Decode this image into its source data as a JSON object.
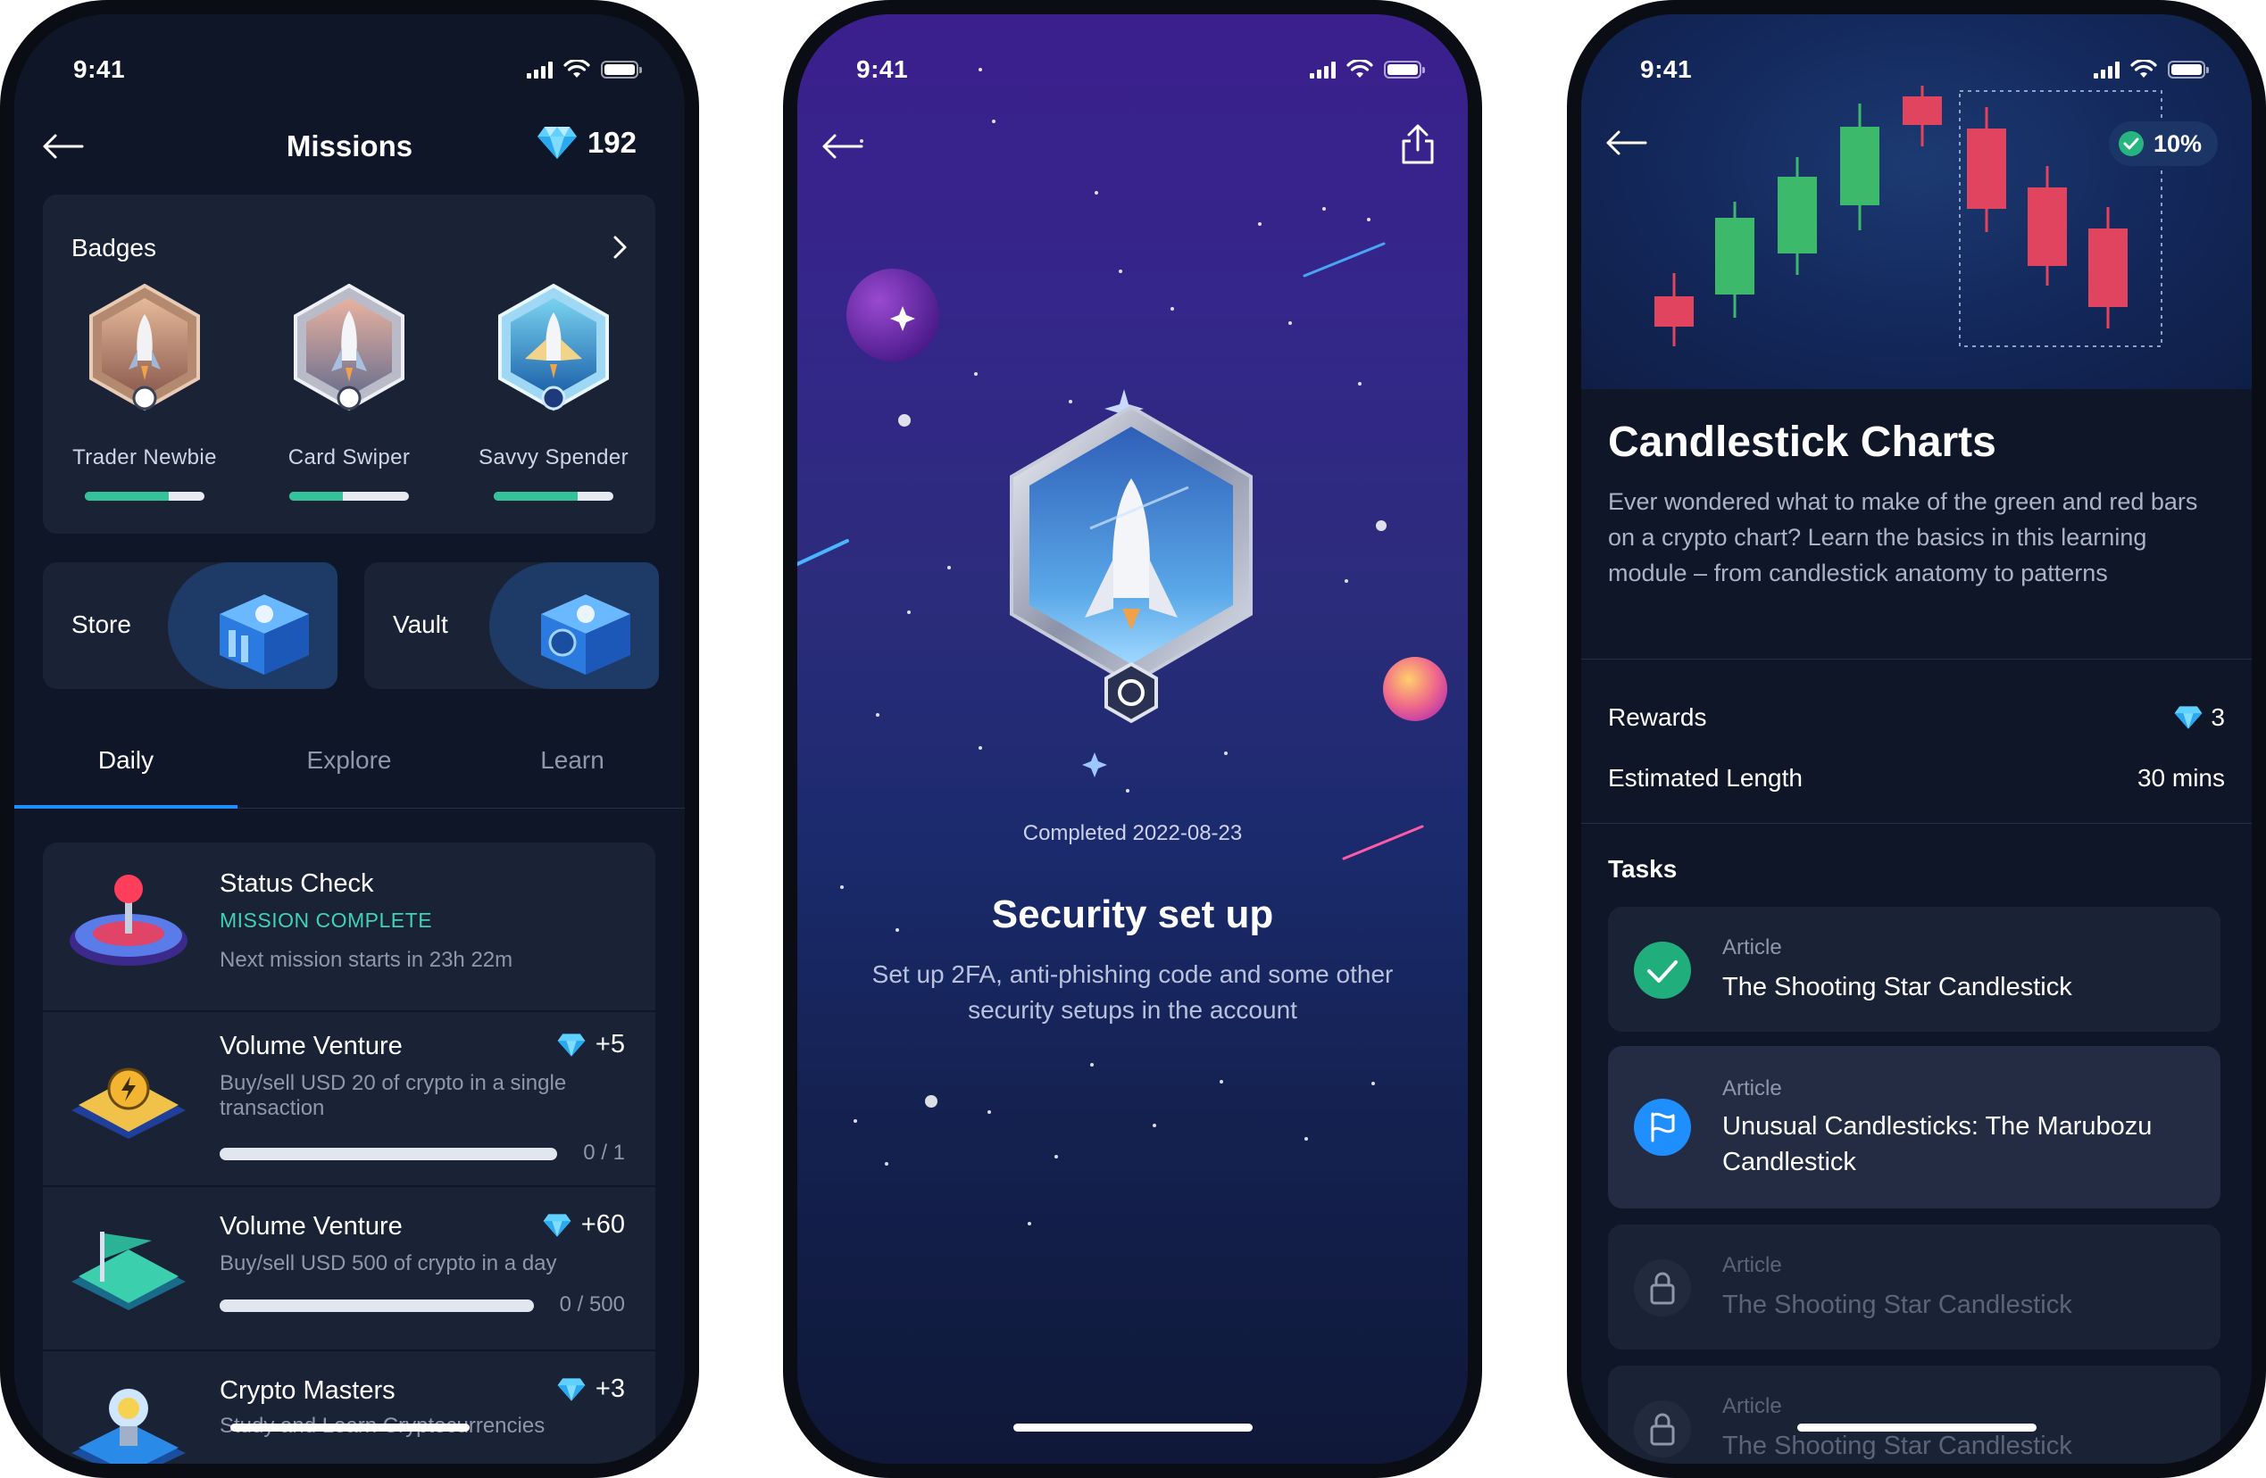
{
  "status": {
    "time": "9:41"
  },
  "missions_screen": {
    "title": "Missions",
    "gem_balance": "192",
    "badges": {
      "title": "Badges",
      "items": [
        {
          "label": "Trader Newbie",
          "progress": 0.7
        },
        {
          "label": "Card Swiper",
          "progress": 0.45
        },
        {
          "label": "Savvy Spender",
          "progress": 0.7
        }
      ]
    },
    "tiles": {
      "store": "Store",
      "vault": "Vault"
    },
    "tabs": [
      "Daily",
      "Explore",
      "Learn"
    ],
    "active_tab": "Daily",
    "missions": [
      {
        "title": "Status Check",
        "status": "MISSION COMPLETE",
        "subtitle": "Next mission starts in 23h 22m"
      },
      {
        "title": "Volume Venture",
        "reward": "+5",
        "subtitle": "Buy/sell USD 20 of crypto in a single transaction",
        "count": "0 / 1",
        "progress": 0
      },
      {
        "title": "Volume Venture",
        "reward": "+60",
        "subtitle": "Buy/sell USD 500 of crypto in a day",
        "count": "0 / 500",
        "progress": 0
      },
      {
        "title": "Crypto Masters",
        "reward": "+3",
        "subtitle": "Study and Learn Cryptocurrencies"
      }
    ]
  },
  "badge_screen": {
    "completed": "Completed 2022-08-23",
    "title": "Security set up",
    "description": "Set up 2FA, anti-phishing code and some other security setups in the account"
  },
  "lesson_screen": {
    "progress_pill": "10%",
    "title": "Candlestick Charts",
    "description": "Ever wondered what to make of the green and red bars on a crypto chart? Learn the basics in this learning module – from candlestick anatomy to patterns",
    "rewards_label": "Rewards",
    "rewards_value": "3",
    "length_label": "Estimated Length",
    "length_value": "30 mins",
    "tasks_title": "Tasks",
    "tasks": [
      {
        "kicker": "Article",
        "title": "The Shooting Star Candlestick",
        "state": "done"
      },
      {
        "kicker": "Article",
        "title": "Unusual Candlesticks: The Marubozu Candlestick",
        "state": "current"
      },
      {
        "kicker": "Article",
        "title": "The Shooting Star Candlestick",
        "state": "locked"
      },
      {
        "kicker": "Article",
        "title": "The Shooting Star Candlestick",
        "state": "locked"
      }
    ]
  },
  "colors": {
    "accent_green": "#32c39a",
    "accent_teal": "#3fd3b4",
    "accent_blue": "#1f8fff",
    "card_bg": "#1a2236",
    "screen_bg": "#0f1628",
    "candle_green": "#3cb96a",
    "candle_red": "#e0445f"
  },
  "icons": [
    "back-arrow-icon",
    "gem-icon",
    "chevron-right-icon",
    "share-icon",
    "check-icon",
    "flag-icon",
    "lock-icon",
    "signal-icon",
    "wifi-icon",
    "battery-icon"
  ]
}
